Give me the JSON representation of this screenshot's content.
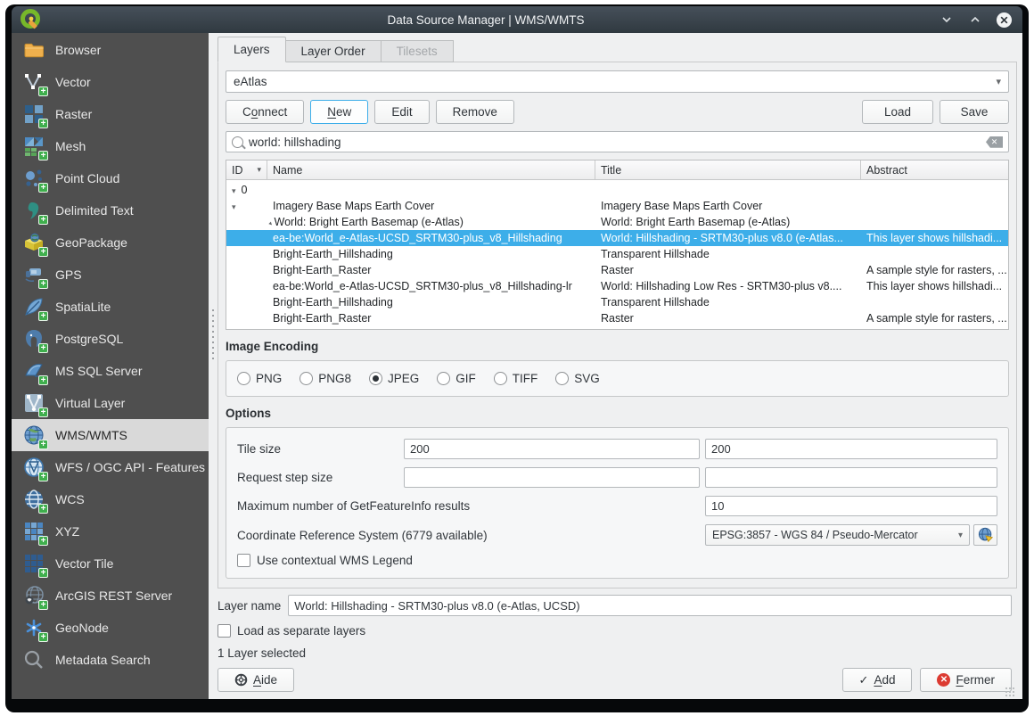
{
  "window": {
    "title": "Data Source Manager | WMS/WMTS"
  },
  "colors": {
    "accent_selection": "#3daee9",
    "titlebar": "#3a444c",
    "sidebar_bg": "#4f4f4f",
    "sidebar_selected_bg": "#d9d9d9",
    "content_bg": "#eff0f1",
    "close_button_red": "#dc3b32",
    "add_badge_green": "#3faf4d"
  },
  "glyphs": {
    "dropdown_arrow": "▾",
    "sort_arrow": "▾",
    "tree_expanded": "▾",
    "clear": "✕",
    "check": "✓",
    "close_x": "✕",
    "plus": "+"
  },
  "sidebar": {
    "items": [
      {
        "label": "Browser"
      },
      {
        "label": "Vector"
      },
      {
        "label": "Raster"
      },
      {
        "label": "Mesh"
      },
      {
        "label": "Point Cloud"
      },
      {
        "label": "Delimited Text"
      },
      {
        "label": "GeoPackage"
      },
      {
        "label": "GPS"
      },
      {
        "label": "SpatiaLite"
      },
      {
        "label": "PostgreSQL"
      },
      {
        "label": "MS SQL Server"
      },
      {
        "label": "Virtual Layer"
      },
      {
        "label": "WMS/WMTS",
        "selected": true
      },
      {
        "label": "WFS / OGC API - Features"
      },
      {
        "label": "WCS"
      },
      {
        "label": "XYZ"
      },
      {
        "label": "Vector Tile"
      },
      {
        "label": "ArcGIS REST Server"
      },
      {
        "label": "GeoNode"
      },
      {
        "label": "Metadata Search"
      }
    ]
  },
  "tabs": [
    {
      "label": "Layers",
      "state": "active"
    },
    {
      "label": "Layer Order",
      "state": "inactive"
    },
    {
      "label": "Tilesets",
      "state": "disabled"
    }
  ],
  "connection": {
    "selected_connection": "eAtlas",
    "buttons": {
      "connect": {
        "pre": "C",
        "key": "o",
        "post": "nnect"
      },
      "new": {
        "pre": "",
        "key": "N",
        "post": "ew"
      },
      "edit": "Edit",
      "remove": "Remove",
      "load": "Load",
      "save": "Save"
    },
    "search_value": "world: hillshading"
  },
  "table": {
    "columns": [
      "ID",
      "Name",
      "Title",
      "Abstract"
    ],
    "rows": [
      {
        "id": "0",
        "name": "",
        "title": "",
        "abstract": ""
      },
      {
        "id": "",
        "name": "Imagery Base Maps Earth Cover",
        "title": "Imagery Base Maps Earth Cover",
        "abstract": ""
      },
      {
        "id": "",
        "name": "World: Bright Earth Basemap (e-Atlas)",
        "title": "World: Bright Earth Basemap (e-Atlas)",
        "abstract": ""
      },
      {
        "id": "",
        "name": "ea-be:World_e-Atlas-UCSD_SRTM30-plus_v8_Hillshading",
        "title": "World: Hillshading - SRTM30-plus v8.0 (e-Atlas...",
        "abstract": "This layer shows hillshadi...",
        "selected": true
      },
      {
        "id": "",
        "name": "Bright-Earth_Hillshading",
        "title": "Transparent Hillshade",
        "abstract": ""
      },
      {
        "id": "",
        "name": "Bright-Earth_Raster",
        "title": "Raster",
        "abstract": "A sample style for rasters, ..."
      },
      {
        "id": "",
        "name": "ea-be:World_e-Atlas-UCSD_SRTM30-plus_v8_Hillshading-lr",
        "title": "World: Hillshading Low Res - SRTM30-plus v8....",
        "abstract": "This layer shows hillshadi..."
      },
      {
        "id": "",
        "name": "Bright-Earth_Hillshading",
        "title": "Transparent Hillshade",
        "abstract": ""
      },
      {
        "id": "",
        "name": "Bright-Earth_Raster",
        "title": "Raster",
        "abstract": "A sample style for rasters, ..."
      }
    ]
  },
  "image_encoding": {
    "label": "Image Encoding",
    "options": [
      {
        "label": "PNG",
        "selected": false
      },
      {
        "label": "PNG8",
        "selected": false
      },
      {
        "label": "JPEG",
        "selected": true
      },
      {
        "label": "GIF",
        "selected": false
      },
      {
        "label": "TIFF",
        "selected": false
      },
      {
        "label": "SVG",
        "selected": false
      }
    ]
  },
  "options": {
    "label": "Options",
    "tile_size_label": "Tile size",
    "tile_size_value_1": "200",
    "tile_size_value_2": "200",
    "request_step_label": "Request step size",
    "request_step_value_1": "",
    "request_step_value_2": "",
    "max_features_label": "Maximum number of GetFeatureInfo results",
    "max_features_value": "10",
    "crs_label": "Coordinate Reference System (6779 available)",
    "crs_value": "EPSG:3857 - WGS 84 / Pseudo-Mercator",
    "legend_checkbox_label": "Use contextual WMS Legend",
    "legend_checked": false
  },
  "footer": {
    "layer_name_label": "Layer name",
    "layer_name_value": "World: Hillshading - SRTM30-plus v8.0 (e-Atlas, UCSD)",
    "load_separate_label": "Load as separate layers",
    "load_separate_checked": false,
    "status": "1 Layer selected",
    "help_button": {
      "pre": "",
      "key": "A",
      "post": "ide"
    },
    "add_button": {
      "pre": "",
      "key": "A",
      "post": "dd"
    },
    "close_button": {
      "pre": "",
      "key": "F",
      "post": "ermer"
    }
  }
}
